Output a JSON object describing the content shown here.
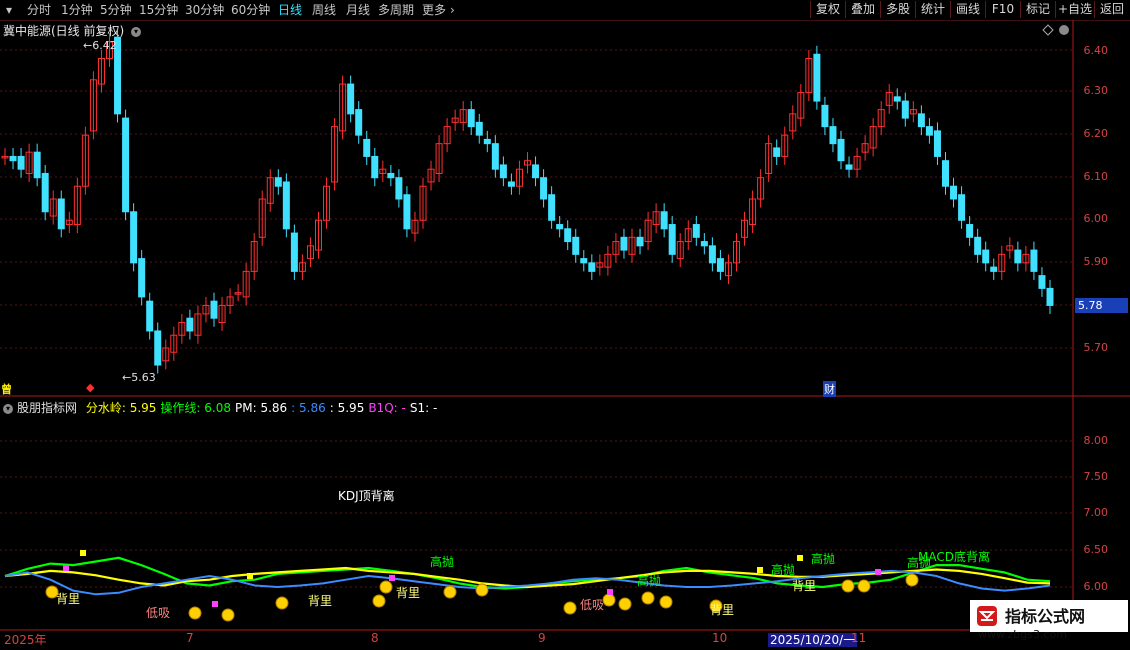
{
  "toolbar": {
    "periods": [
      {
        "label": "分时"
      },
      {
        "label": "1分钟"
      },
      {
        "label": "5分钟"
      },
      {
        "label": "15分钟"
      },
      {
        "label": "30分钟"
      },
      {
        "label": "60分钟"
      },
      {
        "label": "日线",
        "active": true
      },
      {
        "label": "周线"
      },
      {
        "label": "月线"
      },
      {
        "label": "多周期"
      },
      {
        "label": "更多"
      }
    ],
    "right_buttons": [
      "复权",
      "叠加",
      "多股",
      "统计",
      "画线",
      "F10",
      "标记",
      "+自选",
      "返回"
    ]
  },
  "stock": {
    "title": "冀中能源(日线 前复权)"
  },
  "main_chart": {
    "y_ticks": [
      "6.40",
      "6.30",
      "6.20",
      "6.10",
      "6.00",
      "5.90",
      "5.70"
    ],
    "current_price": "5.78",
    "high_label": "6.42",
    "low_label": "5.63",
    "markers": {
      "left_mark": "曾",
      "fin_mark": "财"
    }
  },
  "indicator": {
    "name": "股朋指标网",
    "fields": [
      {
        "label": "分水岭:",
        "value": "5.95",
        "color": "#ffff00"
      },
      {
        "label": "操作线:",
        "value": "6.08",
        "color": "#00ff00"
      },
      {
        "label": "PM:",
        "value": "5.86",
        "color": "#ffffff"
      },
      {
        "label": ":",
        "value": "5.86",
        "color": "#3a8cff"
      },
      {
        "label": ":",
        "value": "5.95",
        "color": "#ffffff"
      },
      {
        "label": "B1Q:",
        "value": "-",
        "color": "#ff40ff"
      },
      {
        "label": "S1:",
        "value": "-",
        "color": "#ffffff"
      }
    ],
    "y_ticks": [
      "8.00",
      "7.50",
      "7.00",
      "6.50",
      "6.00"
    ],
    "annotations": {
      "kdj": "KDJ顶背离",
      "macd": "MACD底背离",
      "gaopao": "高抛",
      "beili": "背里",
      "dixi": "低吸"
    }
  },
  "x_axis": {
    "labels": [
      "2025年",
      "7",
      "8",
      "9",
      "10",
      "2025/10/20/一",
      "11"
    ]
  },
  "watermark": {
    "title": "指标公式网",
    "url": "www.zbgs3.com"
  },
  "colors": {
    "up": "#ff3030",
    "down": "#40e0ff",
    "axis": "#b01818",
    "yellow": "#ffff00",
    "green": "#00ff00",
    "blue": "#3a8cff"
  }
}
